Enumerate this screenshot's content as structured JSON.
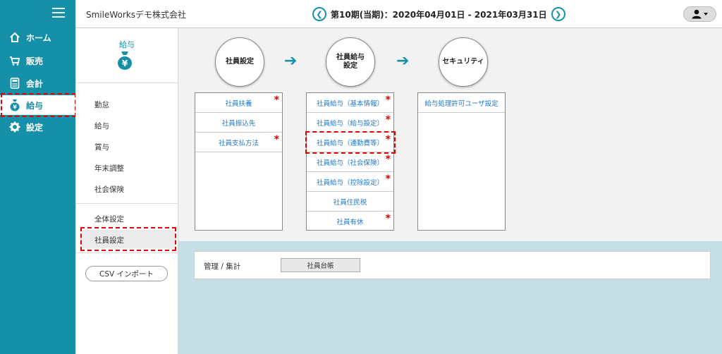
{
  "header": {
    "company": "SmileWorksデモ株式会社",
    "period": "第10期(当期)：2020年04月01日 - 2021年03月31日",
    "prev_icon": "chevron-left-icon",
    "next_icon": "chevron-right-icon",
    "user_icon": "user-icon"
  },
  "nav": {
    "items": [
      {
        "label": "ホーム",
        "icon": "home-icon"
      },
      {
        "label": "販売",
        "icon": "cart-icon"
      },
      {
        "label": "会計",
        "icon": "calculator-icon"
      },
      {
        "label": "給与",
        "icon": "money-bag-icon",
        "active": true
      },
      {
        "label": "設定",
        "icon": "gear-icon"
      }
    ]
  },
  "submenu": {
    "title": "給与",
    "items": [
      "勤怠",
      "給与",
      "賞与",
      "年末調整",
      "社会保険"
    ],
    "settings_items": [
      "全体設定",
      "社員設定"
    ],
    "active_item": "社員設定",
    "csv_button": "CSV インポート"
  },
  "flow": {
    "steps": [
      "社員設定",
      "社員給与設定",
      "セキュリティ"
    ],
    "step_lines": [
      [
        "社員設定"
      ],
      [
        "社員給与",
        "設定"
      ],
      [
        "セキュリティ"
      ]
    ],
    "arrow": "➔"
  },
  "cards": {
    "employee": [
      {
        "label": "社員扶養",
        "required": true
      },
      {
        "label": "社員振込先",
        "required": false
      },
      {
        "label": "社員支払方法",
        "required": true
      }
    ],
    "salary": [
      {
        "label": "社員給与（基本情報）",
        "required": true
      },
      {
        "label": "社員給与（給与設定）",
        "required": true
      },
      {
        "label": "社員給与（通勤費等）",
        "required": true
      },
      {
        "label": "社員給与（社会保険）",
        "required": true
      },
      {
        "label": "社員給与（控除設定）",
        "required": true
      },
      {
        "label": "社員住民税",
        "required": false
      },
      {
        "label": "社員有休",
        "required": true
      }
    ],
    "security": [
      {
        "label": "給与処理許可ユーザ設定",
        "required": false
      }
    ],
    "required_mark": "*"
  },
  "management": {
    "label": "管理 / 集計",
    "button": "社員台帳"
  },
  "colors": {
    "accent": "#1690a8",
    "link": "#1f78c8",
    "required": "#e00000",
    "highlight_border": "#e00000",
    "lower_bg": "#c5dfe5"
  }
}
